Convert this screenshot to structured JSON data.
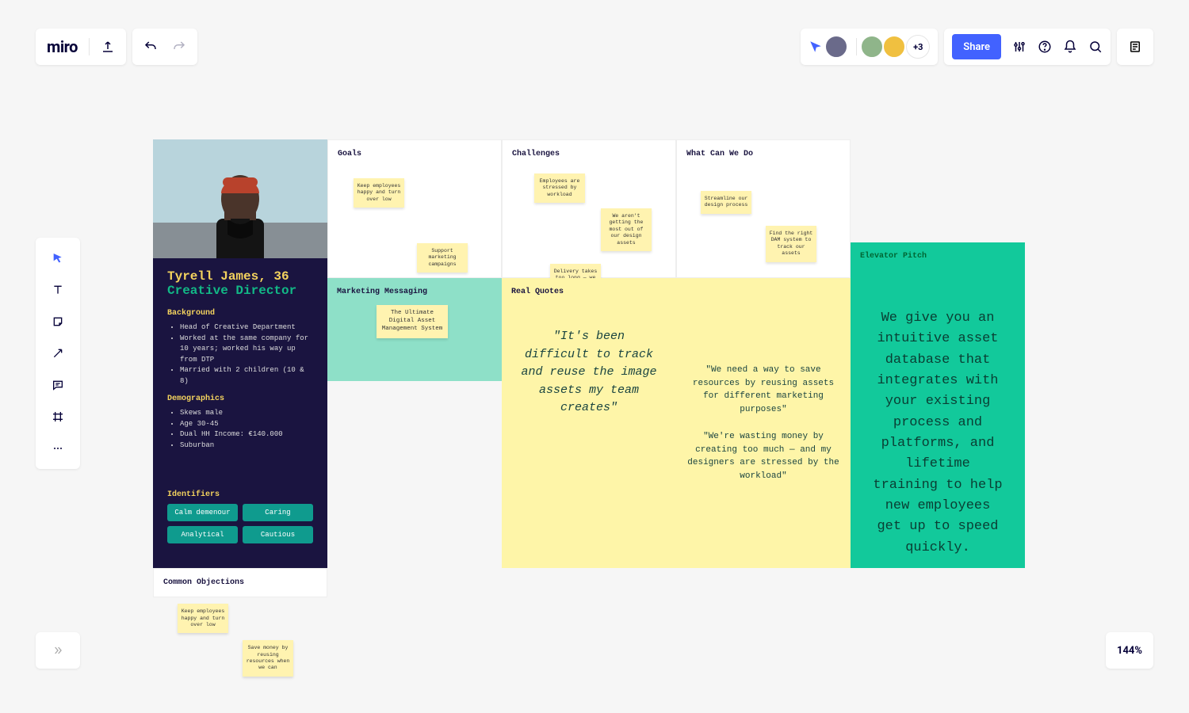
{
  "app": {
    "logo": "miro"
  },
  "toolbar": {
    "share_label": "Share",
    "more_users": "+3"
  },
  "zoom": "144%",
  "persona": {
    "name": "Tyrell James, 36",
    "role": "Creative Director",
    "background_h": "Background",
    "background": [
      "Head of Creative Department",
      "Worked at the same company for 10 years; worked his way up from DTP",
      "Married with 2 children (10 & 8)"
    ],
    "demographics_h": "Demographics",
    "demographics": [
      "Skews male",
      "Age 30-45",
      "Dual HH Income: €140.000",
      "Suburban"
    ],
    "identifiers_h": "Identifiers",
    "identifiers": [
      "Calm demenour",
      "Caring",
      "Analytical",
      "Cautious"
    ]
  },
  "panels": {
    "goals": {
      "title": "Goals",
      "notes": [
        "Keep employees happy and turn over low",
        "Support marketing campaigns"
      ]
    },
    "challenges": {
      "title": "Challenges",
      "notes": [
        "Employees are stressed by workload",
        "We aren't getting the most out of our design assets",
        "Delivery takes too long — we can't keep up with internal demand"
      ]
    },
    "what_can_we_do": {
      "title": "What Can We Do",
      "notes": [
        "Streamline our design process",
        "Find the right DAM system to track our assets"
      ]
    },
    "marketing": {
      "title": "Marketing Messaging",
      "note": "The Ultimate Digital Asset Management System"
    },
    "real_quotes": {
      "title": "Real Quotes",
      "q1": "\"It's been difficult to track and reuse the image assets my team creates\"",
      "q2": "\"We need a way to save resources by reusing assets for different marketing purposes\"",
      "q3": "\"We're wasting money by creating too much — and my designers are stressed by the workload\""
    },
    "objections": {
      "title": "Common Objections",
      "notes": [
        "Keep employees happy and turn over low",
        "Save money by reusing resources when we can"
      ]
    },
    "pitch": {
      "title": "Elevator Pitch",
      "body": "We give you an intuitive asset database that integrates with your existing process and platforms, and lifetime training to help new employees get up to speed quickly."
    }
  }
}
